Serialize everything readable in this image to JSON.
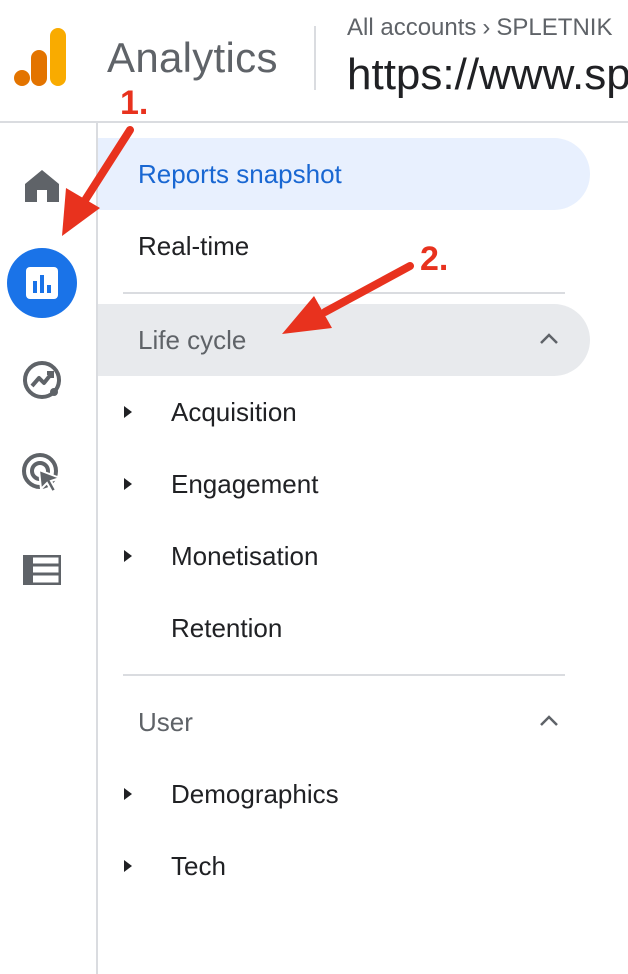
{
  "header": {
    "app_title": "Analytics",
    "breadcrumb": [
      "All accounts",
      "SPLETNIK"
    ],
    "property_name": "https://www.sp"
  },
  "rail": {
    "items": [
      {
        "icon": "home-icon",
        "active": false
      },
      {
        "icon": "reports-icon",
        "active": true
      },
      {
        "icon": "explore-icon",
        "active": false
      },
      {
        "icon": "advertising-icon",
        "active": false
      },
      {
        "icon": "configure-icon",
        "active": false
      }
    ]
  },
  "nav": {
    "reports_snapshot": "Reports snapshot",
    "realtime": "Real-time",
    "lifecycle": {
      "title": "Life cycle",
      "expanded": true,
      "items": [
        {
          "label": "Acquisition",
          "expandable": true
        },
        {
          "label": "Engagement",
          "expandable": true
        },
        {
          "label": "Monetisation",
          "expandable": true
        },
        {
          "label": "Retention",
          "expandable": false
        }
      ]
    },
    "user": {
      "title": "User",
      "expanded": true,
      "items": [
        {
          "label": "Demographics",
          "expandable": true
        },
        {
          "label": "Tech",
          "expandable": true
        }
      ]
    }
  },
  "annotations": {
    "step1": "1.",
    "step2": "2.",
    "color": "#e8321e"
  },
  "colors": {
    "accent": "#1a73e8",
    "active_bg": "#e8f0fe",
    "section_bg": "#e8eaed",
    "logo_orange": "#f9ab00",
    "logo_dark_orange": "#e37400"
  }
}
